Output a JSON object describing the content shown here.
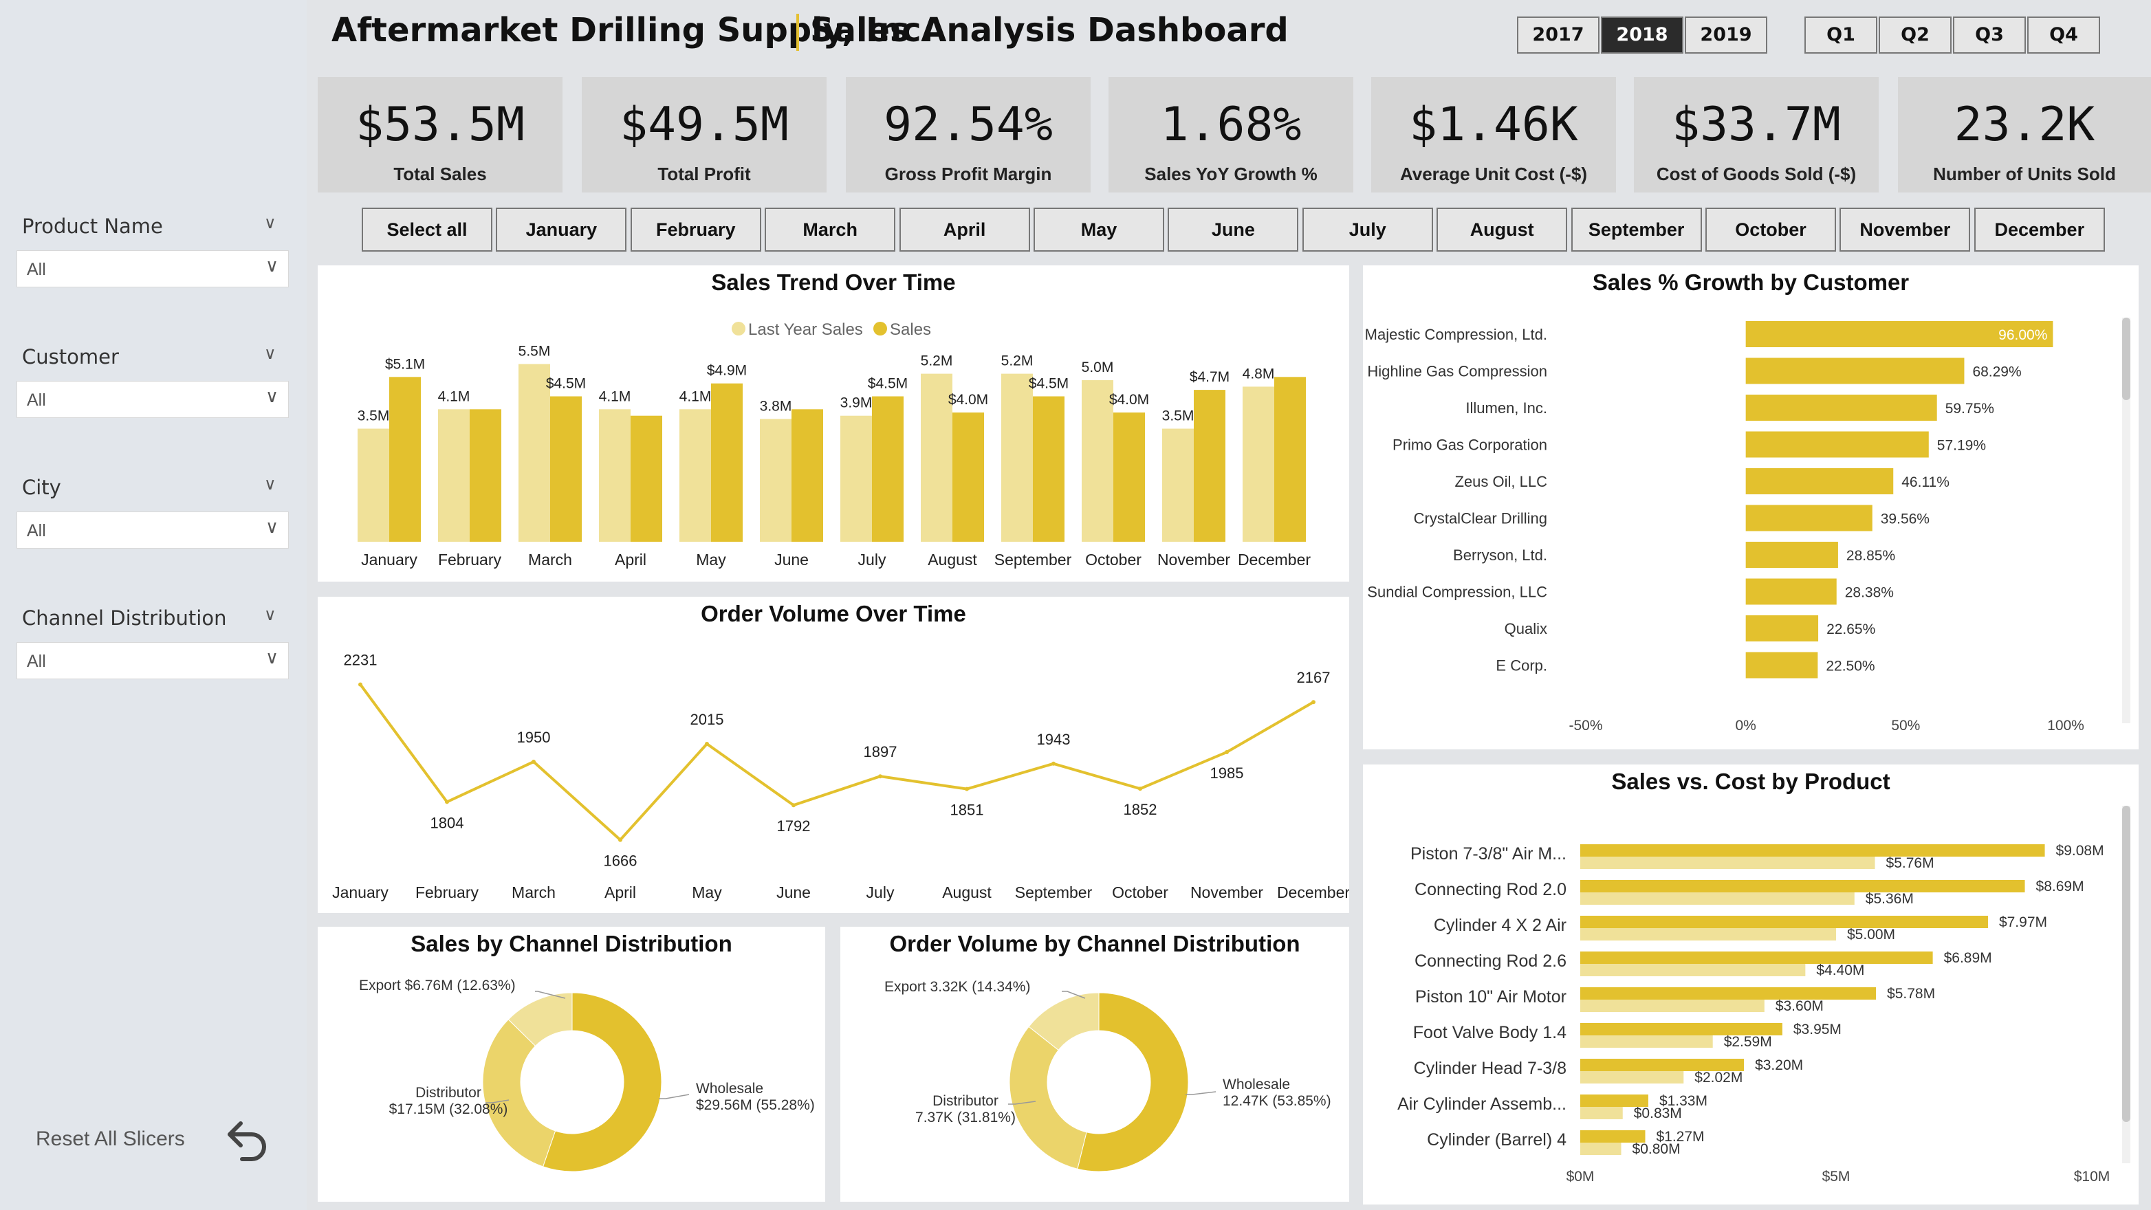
{
  "header": {
    "company": "Aftermarket Drilling Supply, Inc.",
    "title": "Sales Analysis Dashboard"
  },
  "years": [
    {
      "label": "2017",
      "selected": false
    },
    {
      "label": "2018",
      "selected": true
    },
    {
      "label": "2019",
      "selected": false
    }
  ],
  "quarters": [
    "Q1",
    "Q2",
    "Q3",
    "Q4"
  ],
  "kpis": [
    {
      "value": "$53.5M",
      "label": "Total Sales"
    },
    {
      "value": "$49.5M",
      "label": "Total Profit"
    },
    {
      "value": "92.54%",
      "label": "Gross Profit Margin"
    },
    {
      "value": "1.68%",
      "label": "Sales YoY Growth %"
    },
    {
      "value": "$1.46K",
      "label": "Average Unit Cost (-$)"
    },
    {
      "value": "$33.7M",
      "label": "Cost of Goods Sold (-$)"
    },
    {
      "value": "23.2K",
      "label": "Number of Units Sold"
    }
  ],
  "months": [
    "Select all",
    "January",
    "February",
    "March",
    "April",
    "May",
    "June",
    "July",
    "August",
    "September",
    "October",
    "November",
    "December"
  ],
  "slicers": [
    {
      "title": "Product Name",
      "value": "All"
    },
    {
      "title": "Customer",
      "value": "All"
    },
    {
      "title": "City",
      "value": "All"
    },
    {
      "title": "Channel Distribution",
      "value": "All"
    }
  ],
  "reset_label": "Reset All Slicers",
  "colors": {
    "accent": "#e3c12e",
    "light": "#f0e199",
    "mid": "#ebd46a"
  },
  "chart_data": [
    {
      "id": "sales_trend",
      "type": "bar",
      "title": "Sales Trend Over Time",
      "legend": [
        "Last Year Sales",
        "Sales"
      ],
      "categories": [
        "January",
        "February",
        "March",
        "April",
        "May",
        "June",
        "July",
        "August",
        "September",
        "October",
        "November",
        "December"
      ],
      "series": [
        {
          "name": "Last Year Sales",
          "values": [
            3.5,
            4.1,
            5.5,
            4.1,
            4.1,
            3.8,
            3.9,
            5.2,
            5.2,
            5.0,
            3.5,
            4.8
          ],
          "labels": [
            "3.5M",
            "4.1M",
            "5.5M",
            "4.1M",
            "4.1M",
            "3.8M",
            "3.9M",
            "5.2M",
            "5.2M",
            "5.0M",
            "3.5M",
            "4.8M"
          ]
        },
        {
          "name": "Sales",
          "values": [
            5.1,
            4.1,
            4.5,
            3.9,
            4.9,
            4.1,
            4.5,
            4.0,
            4.5,
            4.0,
            4.7,
            5.1
          ],
          "labels": [
            "$5.1M",
            "",
            "$4.5M",
            "",
            "$4.9M",
            "",
            "$4.5M",
            "$4.0M",
            "$4.5M",
            "$4.0M",
            "$4.7M",
            ""
          ]
        }
      ],
      "ylim": [
        0,
        6
      ]
    },
    {
      "id": "order_volume",
      "type": "line",
      "title": "Order Volume Over Time",
      "categories": [
        "January",
        "February",
        "March",
        "April",
        "May",
        "June",
        "July",
        "August",
        "September",
        "October",
        "November",
        "December"
      ],
      "values": [
        2231,
        1804,
        1950,
        1666,
        2015,
        1792,
        1897,
        1851,
        1943,
        1852,
        1985,
        2167
      ],
      "ylim": [
        1600,
        2300
      ]
    },
    {
      "id": "sales_growth_customer",
      "type": "bar",
      "title": "Sales % Growth by Customer",
      "categories": [
        "Majestic Compression, Ltd.",
        "Highline Gas Compression",
        "Illumen, Inc.",
        "Primo Gas Corporation",
        "Zeus Oil, LLC",
        "CrystalClear Drilling",
        "Berryson, Ltd.",
        "Sundial Compression, LLC",
        "Qualix",
        "E Corp."
      ],
      "values": [
        96.0,
        68.29,
        59.75,
        57.19,
        46.11,
        39.56,
        28.85,
        28.38,
        22.65,
        22.5
      ],
      "labels": [
        "96.00%",
        "68.29%",
        "59.75%",
        "57.19%",
        "46.11%",
        "39.56%",
        "28.85%",
        "28.38%",
        "22.65%",
        "22.50%"
      ],
      "xticks": [
        "-50%",
        "0%",
        "50%",
        "100%"
      ],
      "xlim": [
        -50,
        100
      ]
    },
    {
      "id": "sales_vs_cost",
      "type": "bar",
      "title": "Sales vs. Cost by Product",
      "categories": [
        "Piston 7-3/8\" Air M...",
        "Connecting Rod 2.0",
        "Cylinder 4 X 2 Air",
        "Connecting Rod 2.6",
        "Piston 10\" Air Motor",
        "Foot Valve Body 1.4",
        "Cylinder Head 7-3/8",
        "Air Cylinder Assemb...",
        "Cylinder (Barrel) 4"
      ],
      "series": [
        {
          "name": "Sales",
          "values": [
            9.08,
            8.69,
            7.97,
            6.89,
            5.78,
            3.95,
            3.2,
            1.33,
            1.27
          ],
          "labels": [
            "$9.08M",
            "$8.69M",
            "$7.97M",
            "$6.89M",
            "$5.78M",
            "$3.95M",
            "$3.20M",
            "$1.33M",
            "$1.27M"
          ]
        },
        {
          "name": "Cost",
          "values": [
            5.76,
            5.36,
            5.0,
            4.4,
            3.6,
            2.59,
            2.02,
            0.83,
            0.8
          ],
          "labels": [
            "$5.76M",
            "$5.36M",
            "$5.00M",
            "$4.40M",
            "$3.60M",
            "$2.59M",
            "$2.02M",
            "$0.83M",
            "$0.80M"
          ]
        }
      ],
      "xticks": [
        "$0M",
        "$5M",
        "$10M"
      ],
      "xlim": [
        0,
        10
      ]
    },
    {
      "id": "sales_by_channel",
      "type": "pie",
      "title": "Sales by Channel Distribution",
      "categories": [
        "Wholesale",
        "Distributor",
        "Export"
      ],
      "values": [
        55.28,
        32.08,
        12.63
      ],
      "labels": [
        "Wholesale\n$29.56M (55.28%)",
        "Distributor\n$17.15M (32.08%)",
        "Export $6.76M (12.63%)"
      ]
    },
    {
      "id": "orders_by_channel",
      "type": "pie",
      "title": "Order Volume by Channel Distribution",
      "categories": [
        "Wholesale",
        "Distributor",
        "Export"
      ],
      "values": [
        53.85,
        31.81,
        14.34
      ],
      "labels": [
        "Wholesale\n12.47K (53.85%)",
        "Distributor\n7.37K (31.81%)",
        "Export 3.32K (14.34%)"
      ]
    }
  ]
}
